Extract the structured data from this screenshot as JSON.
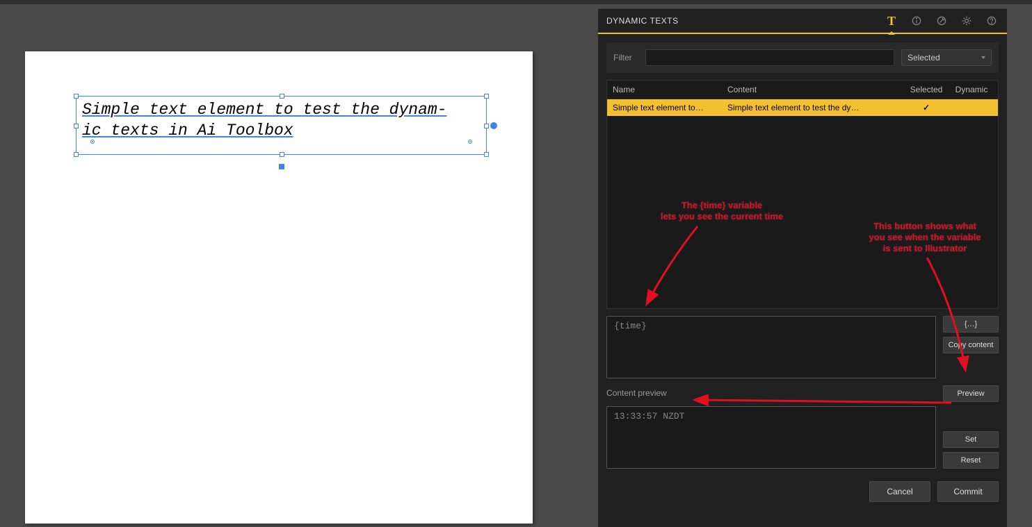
{
  "colors": {
    "accent": "#f5c030",
    "selection": "#4084e8",
    "annotation": "#e01020"
  },
  "artboard_text": "Simple text element to test the dynam-\nic texts in Ai Toolbox",
  "panel": {
    "title": "DYNAMIC TEXTS",
    "icons": [
      "text",
      "info",
      "tool",
      "settings",
      "help"
    ]
  },
  "filter": {
    "label": "Filter",
    "value": "",
    "selected_option": "Selected"
  },
  "table": {
    "columns": {
      "name": "Name",
      "content": "Content",
      "selected": "Selected",
      "dynamic": "Dynamic"
    },
    "rows": [
      {
        "name": "Simple text element to…",
        "content": "Simple text element to test the dy…",
        "selected": true,
        "dynamic": false
      }
    ]
  },
  "annotations": {
    "time_var": "The {time} variable\nlets you see the current time",
    "preview_btn": "This button shows what\nyou see when the variable\nis sent to Illustrator"
  },
  "editor": {
    "placeholder": "{time}"
  },
  "buttons": {
    "braces": "{…}",
    "copy_content": "Copy content",
    "preview": "Preview",
    "set": "Set",
    "reset": "Reset",
    "cancel": "Cancel",
    "commit": "Commit"
  },
  "preview": {
    "label": "Content preview",
    "value": "13:33:57 NZDT"
  }
}
